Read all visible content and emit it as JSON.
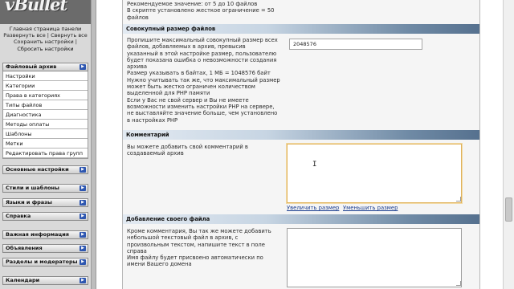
{
  "logo": {
    "text": "vBullet"
  },
  "sidebar": {
    "links": {
      "main_page": "Главная страница панели",
      "expand_all": "Развернуть все",
      "separator": " | ",
      "collapse_all": "Свернуть все",
      "save_settings": "Сохранить настройки",
      "save_sep": " | ",
      "reset_settings": "Сбросить настройки"
    },
    "file_archive": {
      "title": "Файловый архив",
      "items": [
        "Настройки",
        "Категории",
        "Права в категориях",
        "Типы файлов",
        "Диагностика",
        "Методы оплаты",
        "Шаблоны",
        "Метки",
        "Редактировать права групп"
      ]
    },
    "groups": [
      "Основные настройки",
      "Стили и шаблоны",
      "Языки и фразы",
      "Справка",
      "Важная информация",
      "Объявления",
      "Разделы и модераторы",
      "Календари"
    ],
    "arrow_glyph": "▶"
  },
  "main": {
    "top_description": [
      "Рекомендуемое значение: от 5 до 10 файлов",
      "В скрипте установлено жесткое ограничение = 50",
      "файлов"
    ],
    "max_size": {
      "header": "Совокупный размер файлов",
      "description": [
        "Пропишите максимальный совокупный размер всех",
        "файлов, добавляемых в архив, превысив",
        "указанный в этой настройке размер, пользователю",
        "будет показана ошибка о невозможности создания",
        "архива",
        "Размер указывать в байтах, 1 МБ = 1048576 байт",
        "Нужно учитывать так же, что максимальный размер",
        "может быть жестко ограничен количеством",
        "выделенной для PHP памяти",
        "Если у Вас не свой сервер и Вы не имеете",
        "возможности изменить настройки PHP на сервере,",
        "не выставляйте значение больше, чем установлено",
        "в настройках PHP"
      ],
      "value": "2048576"
    },
    "comment": {
      "header": "Комментарий",
      "description": [
        "Вы можете добавить свой комментарий в",
        "создаваемый архив"
      ],
      "value": "",
      "increase_size": "Увеличить размер",
      "decrease_size": "Уменьшить размер"
    },
    "own_file": {
      "header": "Добавление своего файла",
      "description": [
        "Кроме комментария, Вы так же можете добавить",
        "небольшой текстовый файл в архив, с",
        "произвольным текстом, напишите текст в поле",
        "справа",
        "Имя файлу будет присвоено автоматически по",
        "имени Вашего домена"
      ],
      "value": ""
    },
    "text_cursor": "I"
  },
  "colors": {
    "section_header_start": "#e3eaf2",
    "section_header_end": "#55708e",
    "link": "#1a3d8f",
    "focus_border": "#e0b25a",
    "nav_arrow": "#2d56b0"
  }
}
